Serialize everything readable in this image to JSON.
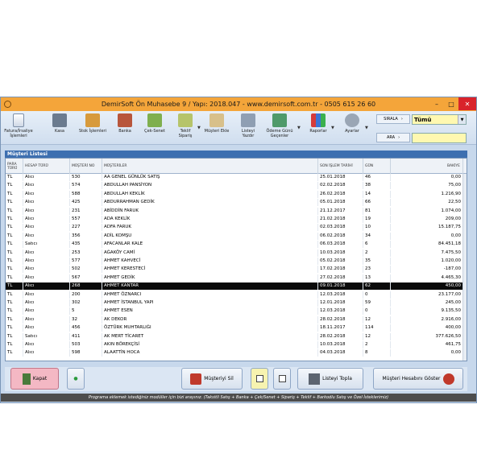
{
  "window": {
    "title": "DemirSoft Ön Muhasebe 9 / Yapı: 2018.047 - www.demirsoft.com.tr - 0505 615 26 60",
    "minimize": "–",
    "maximize": "□",
    "close": "✕"
  },
  "toolbar": {
    "items": [
      {
        "label": "Fatura/İrsaliye İşlemleri",
        "icon": "invoice-icon"
      },
      {
        "label": "Kasa",
        "icon": "cash-register-icon"
      },
      {
        "label": "Stok İşlemleri",
        "icon": "stock-icon"
      },
      {
        "label": "Banka",
        "icon": "bank-icon"
      },
      {
        "label": "Çek-Senet",
        "icon": "check-icon"
      },
      {
        "label": "Teklif Sipariş",
        "icon": "offer-icon"
      },
      {
        "label": "Müşteri Ekle",
        "icon": "add-customer-icon"
      },
      {
        "label": "Listeyi Yazdır",
        "icon": "print-icon"
      },
      {
        "label": "Ödeme Günü Geçenler",
        "icon": "overdue-icon"
      },
      {
        "label": "Raporlar",
        "icon": "reports-icon"
      },
      {
        "label": "Ayarlar",
        "icon": "settings-icon"
      }
    ],
    "sirala_label": "SIRALA",
    "ara_label": "ARA",
    "sirala_value": "Tümü",
    "ara_value": ""
  },
  "list": {
    "title": "Müşteri Listesi",
    "columns": [
      "PARA TÜRÜ",
      "HESAP TÜRÜ",
      "MÜŞTERİ NO",
      "MÜŞTERİLER",
      "SON İŞLEM TARİHİ",
      "GÜN",
      "BAKİYE"
    ],
    "rows": [
      [
        "TL",
        "Alıcı",
        "530",
        "AA GENEL GÜNLÜK SATIŞ",
        "25.01.2018",
        "46",
        "0,00"
      ],
      [
        "TL",
        "Alıcı",
        "574",
        "ABDULLAH PANSİYON",
        "02.02.2018",
        "38",
        "75,00"
      ],
      [
        "TL",
        "Alıcı",
        "588",
        "ABDULLAH KEKLİK",
        "26.02.2018",
        "14",
        "1.216,90"
      ],
      [
        "TL",
        "Alıcı",
        "425",
        "ABDURRAHMAN GEDİK",
        "05.01.2018",
        "66",
        "22,50"
      ],
      [
        "TL",
        "Alıcı",
        "231",
        "ABİDDİN FARUK",
        "21.12.2017",
        "81",
        "1.074,00"
      ],
      [
        "TL",
        "Alıcı",
        "557",
        "ADA KEKLİK",
        "21.02.2018",
        "19",
        "209,00"
      ],
      [
        "TL",
        "Alıcı",
        "227",
        "ADFA FARUK",
        "02.03.2018",
        "10",
        "15.187,75"
      ],
      [
        "TL",
        "Alıcı",
        "356",
        "ADİL KOMŞU",
        "06.02.2018",
        "34",
        "0,00"
      ],
      [
        "TL",
        "Satıcı",
        "435",
        "AFACANLAR KALE",
        "06.03.2018",
        "6",
        "84.451,18"
      ],
      [
        "TL",
        "Alıcı",
        "253",
        "AĞAKÖY CAMİ",
        "10.03.2018",
        "2",
        "7.475,50"
      ],
      [
        "TL",
        "Alıcı",
        "577",
        "AHMET KAHVECİ",
        "05.02.2018",
        "35",
        "1.020,00"
      ],
      [
        "TL",
        "Alıcı",
        "502",
        "AHMET KERESTECİ",
        "17.02.2018",
        "23",
        "-187,00"
      ],
      [
        "TL",
        "Alıcı",
        "567",
        "AHMET GEDİK",
        "27.02.2018",
        "13",
        "4.465,30"
      ],
      [
        "TL",
        "Alıcı",
        "268",
        "AHMET KANTAR",
        "09.01.2018",
        "62",
        "450,00"
      ],
      [
        "TL",
        "Alıcı",
        "200",
        "AHMET ÖZNARCI",
        "12.03.2018",
        "0",
        "23.177,00"
      ],
      [
        "TL",
        "Alıcı",
        "302",
        "AHMET İSTANBUL YAPI",
        "12.01.2018",
        "59",
        "245,00"
      ],
      [
        "TL",
        "Alıcı",
        "5",
        "AHMET ESEN",
        "12.03.2018",
        "0",
        "9.135,50"
      ],
      [
        "TL",
        "Alıcı",
        "32",
        "AK DEKOR",
        "28.02.2018",
        "12",
        "2.916,00"
      ],
      [
        "TL",
        "Alıcı",
        "456",
        "ÖZTÜRK MUHTARLIĞI",
        "18.11.2017",
        "114",
        "400,00"
      ],
      [
        "TL",
        "Satıcı",
        "411",
        "AK MERT TİCARET",
        "28.02.2018",
        "12",
        "377.626,50"
      ],
      [
        "TL",
        "Alıcı",
        "503",
        "AKIN BÖREKÇİSİ",
        "10.03.2018",
        "2",
        "461,75"
      ],
      [
        "TL",
        "Alıcı",
        "598",
        "ALAATTİN HOCA",
        "04.03.2018",
        "8",
        "0,00"
      ]
    ],
    "selected_index": 13
  },
  "footer": {
    "kapat": "Kapat",
    "musteri_sil": "Müşteriyi Sil",
    "listeyi_topla": "Listeyi Topla",
    "hesabini_goster": "Müşteri Hesabını Göster",
    "dot": "●"
  },
  "statusbar": {
    "text": "Programa eklemek istediğiniz modüller için bizi arayınız. (Taksitli Satış + Banka + Çek/Senet + Sipariş + Teklif + Barkodlu Satış ve Özel İsteklerimiz)"
  },
  "colors": {
    "titlebar": "#f4a53a",
    "selected_row": "#0a0a0a",
    "list_title": "#3d6fb0",
    "highlight_input": "#fff8b0"
  }
}
